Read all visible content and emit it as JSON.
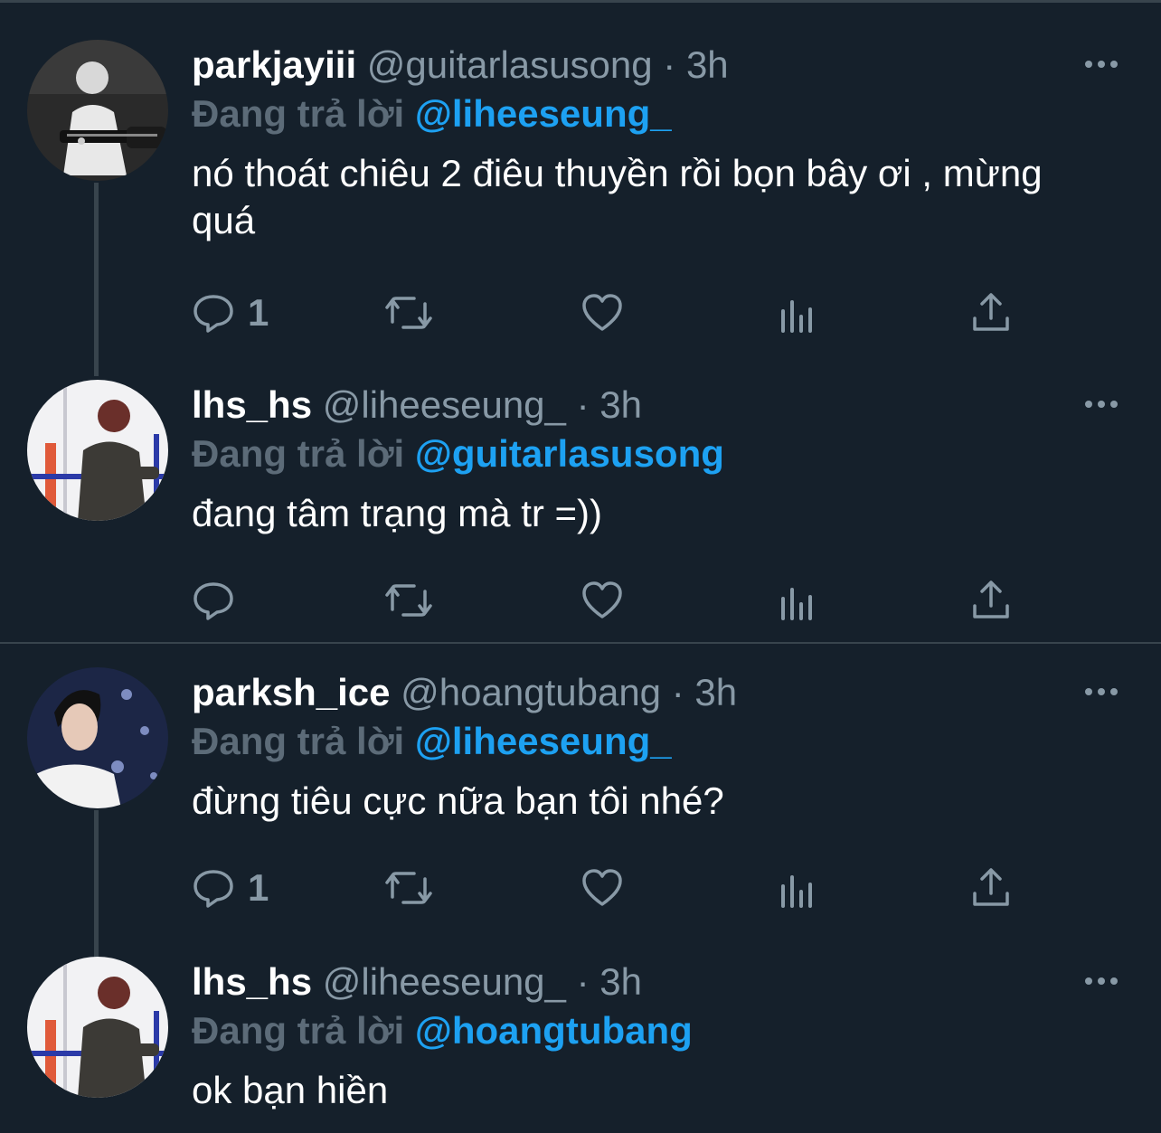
{
  "threads": [
    {
      "tweets": [
        {
          "display_name": "parkjayiii",
          "handle": "@guitarlasusong",
          "separator": "·",
          "time": "3h",
          "replying_prefix": "Đang trả lời",
          "replying_to": "@liheeseung_",
          "text": "nó thoát chiêu 2 điêu thuyền rồi bọn bây ơi , mừng quá",
          "reply_count": "1",
          "avatar_icon": "guitarist-avatar-icon"
        },
        {
          "display_name": "lhs_hs",
          "handle": "@liheeseung_",
          "separator": "·",
          "time": "3h",
          "replying_prefix": "Đang trả lời",
          "replying_to": "@guitarlasusong",
          "text": "đang tâm trạng mà tr =))",
          "reply_count": "",
          "avatar_icon": "stage-person-avatar-icon"
        }
      ]
    },
    {
      "tweets": [
        {
          "display_name": "parksh_ice",
          "handle": "@hoangtubang",
          "separator": "·",
          "time": "3h",
          "replying_prefix": "Đang trả lời",
          "replying_to": "@liheeseung_",
          "text": "đừng tiêu cực nữa bạn tôi nhé?",
          "reply_count": "1",
          "avatar_icon": "portrait-avatar-icon"
        },
        {
          "display_name": "lhs_hs",
          "handle": "@liheeseung_",
          "separator": "·",
          "time": "3h",
          "replying_prefix": "Đang trả lời",
          "replying_to": "@hoangtubang",
          "text": "ok bạn hiền",
          "reply_count": "",
          "avatar_icon": "stage-person-avatar-icon"
        }
      ]
    }
  ],
  "icons": {
    "reply": "reply-icon",
    "retweet": "retweet-icon",
    "like": "like-icon",
    "analytics": "analytics-icon",
    "share": "share-icon",
    "more": "more-icon"
  },
  "colors": {
    "background": "#15202b",
    "accent": "#1da1f2",
    "secondary_text": "#8899a6",
    "border": "#38444d"
  }
}
